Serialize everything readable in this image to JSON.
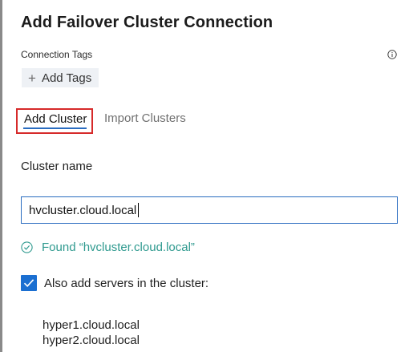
{
  "dialog": {
    "title": "Add Failover Cluster Connection"
  },
  "connection_tags": {
    "label": "Connection Tags",
    "add_tags_label": "Add Tags",
    "info_icon": "info-icon"
  },
  "tabs": [
    {
      "label": "Add Cluster",
      "selected": true
    },
    {
      "label": "Import Clusters",
      "selected": false
    }
  ],
  "cluster": {
    "name_label": "Cluster name",
    "name_value": "hvcluster.cloud.local",
    "found_text": "Found “hvcluster.cloud.local”",
    "found_color": "#2f9a8f"
  },
  "servers": {
    "checkbox_label": "Also add servers in the cluster:",
    "checked": true,
    "items": [
      "hyper1.cloud.local",
      "hyper2.cloud.local"
    ]
  },
  "colors": {
    "accent": "#1b6fd1",
    "highlight_box": "#d62a2a",
    "tab_underline": "#2a6cc0"
  }
}
